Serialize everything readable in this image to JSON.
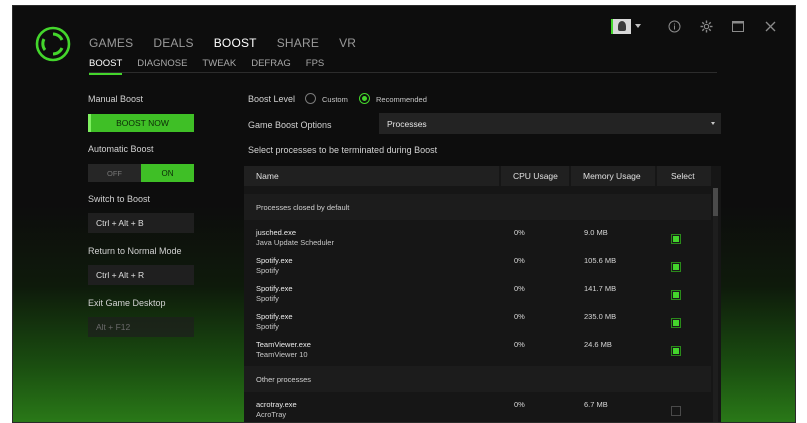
{
  "nav": {
    "main": [
      "GAMES",
      "DEALS",
      "BOOST",
      "SHARE",
      "VR"
    ],
    "main_active": 2,
    "sub": [
      "BOOST",
      "DIAGNOSE",
      "TWEAK",
      "DEFRAG",
      "FPS"
    ],
    "sub_active": 0
  },
  "titlebar": {
    "icons": [
      "avatar",
      "chevron-down-icon",
      "info-icon",
      "gear-icon",
      "maximize-icon",
      "close-icon"
    ]
  },
  "left": {
    "manual_boost_label": "Manual Boost",
    "boost_now_label": "BOOST NOW",
    "automatic_boost_label": "Automatic Boost",
    "toggle_off": "OFF",
    "toggle_on": "ON",
    "switch_to_boost_label": "Switch to Boost",
    "switch_to_boost_value": "Ctrl + Alt + B",
    "return_normal_label": "Return to Normal Mode",
    "return_normal_value": "Ctrl + Alt + R",
    "exit_desktop_label": "Exit Game Desktop",
    "exit_desktop_value": "Alt + F12"
  },
  "right": {
    "boost_level_label": "Boost Level",
    "radio_custom": "Custom",
    "radio_recommended": "Recommended",
    "selected_level": "Recommended",
    "game_boost_options_label": "Game Boost Options",
    "game_boost_options_value": "Processes",
    "select_processes_label": "Select processes to be terminated during Boost"
  },
  "table": {
    "columns": [
      "Name",
      "CPU Usage",
      "Memory Usage",
      "Select"
    ],
    "group_default": "Processes closed by default",
    "group_other": "Other processes",
    "default_rows": [
      {
        "name": "jusched.exe",
        "desc": "Java Update Scheduler",
        "cpu": "0%",
        "mem": "9.0 MB",
        "selected": true
      },
      {
        "name": "Spotify.exe",
        "desc": "Spotify",
        "cpu": "0%",
        "mem": "105.6 MB",
        "selected": true
      },
      {
        "name": "Spotify.exe",
        "desc": "Spotify",
        "cpu": "0%",
        "mem": "141.7 MB",
        "selected": true
      },
      {
        "name": "Spotify.exe",
        "desc": "Spotify",
        "cpu": "0%",
        "mem": "235.0 MB",
        "selected": true
      },
      {
        "name": "TeamViewer.exe",
        "desc": "TeamViewer 10",
        "cpu": "0%",
        "mem": "24.6 MB",
        "selected": true
      }
    ],
    "other_rows": [
      {
        "name": "acrotray.exe",
        "desc": "AcroTray",
        "cpu": "0%",
        "mem": "6.7 MB",
        "selected": false
      }
    ]
  },
  "colors": {
    "accent": "#44d62c",
    "background": "#0d0d0d"
  }
}
